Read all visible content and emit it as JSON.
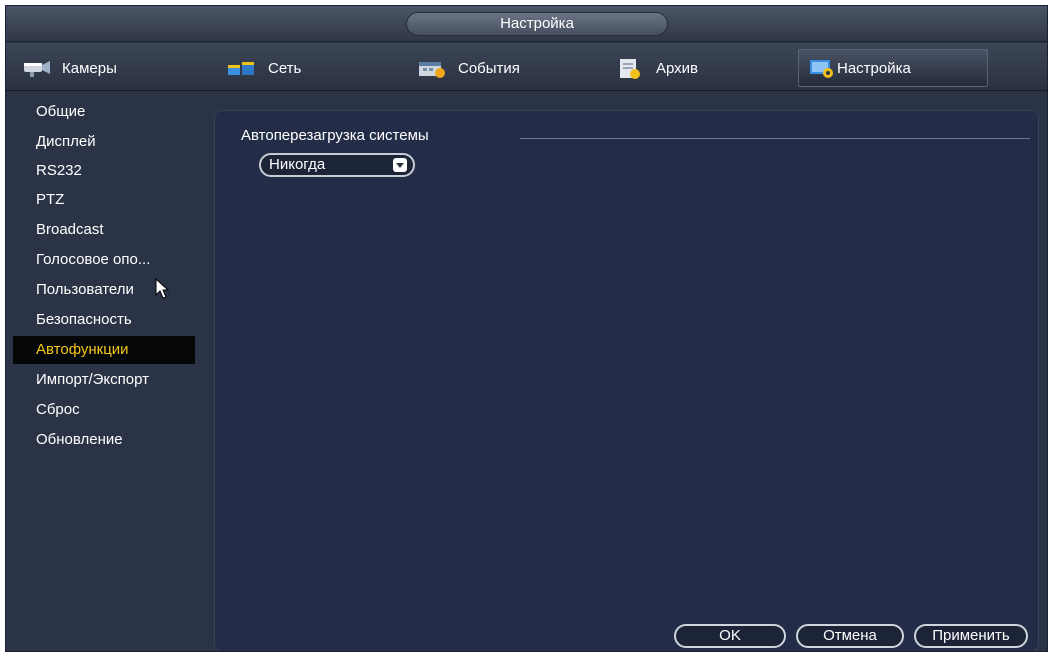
{
  "window": {
    "title": "Настройка"
  },
  "tabs": [
    {
      "label": "Камеры",
      "icon": "camera-icon",
      "active": false
    },
    {
      "label": "Сеть",
      "icon": "network-icon",
      "active": false
    },
    {
      "label": "События",
      "icon": "events-icon",
      "active": false
    },
    {
      "label": "Архив",
      "icon": "archive-icon",
      "active": false
    },
    {
      "label": "Настройка",
      "icon": "settings-icon",
      "active": true
    }
  ],
  "sidebar": {
    "items": [
      {
        "label": "Общие"
      },
      {
        "label": "Дисплей"
      },
      {
        "label": "RS232"
      },
      {
        "label": "PTZ"
      },
      {
        "label": "Broadcast"
      },
      {
        "label": "Голосовое опо..."
      },
      {
        "label": "Пользователи"
      },
      {
        "label": "Безопасность"
      },
      {
        "label": "Автофункции",
        "active": true
      },
      {
        "label": "Импорт/Экспорт"
      },
      {
        "label": "Сброс"
      },
      {
        "label": "Обновление"
      }
    ]
  },
  "main": {
    "section_label": "Автоперезагрузка системы",
    "reboot_select": {
      "value": "Никогда"
    }
  },
  "buttons": {
    "ok_label": "OK",
    "cancel_label": "Отмена",
    "apply_label": "Применить"
  },
  "colors": {
    "active_menu_text": "#f5c61a",
    "panel_bg": "#232d47",
    "window_bg": "#2b3446"
  }
}
